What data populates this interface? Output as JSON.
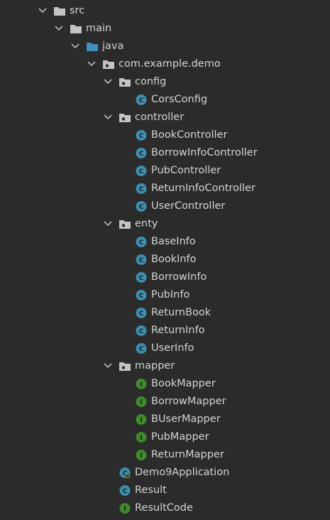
{
  "colors": {
    "background": "#2b2b2b",
    "text": "#d4d4d4",
    "folder": "#c4c4c4",
    "source_folder": "#3f8fc1",
    "class_icon": "#3d8fb0",
    "interface_icon": "#3e8a2c"
  },
  "tree": [
    {
      "label": "src",
      "depth": 0,
      "icon": "folder-icon",
      "expanded": true
    },
    {
      "label": "main",
      "depth": 1,
      "icon": "folder-icon",
      "expanded": true
    },
    {
      "label": "java",
      "depth": 2,
      "icon": "source-folder-icon",
      "expanded": true
    },
    {
      "label": "com.example.demo",
      "depth": 3,
      "icon": "package-icon",
      "expanded": true
    },
    {
      "label": "config",
      "depth": 4,
      "icon": "package-icon",
      "expanded": true
    },
    {
      "label": "CorsConfig",
      "depth": 5,
      "icon": "class-icon"
    },
    {
      "label": "controller",
      "depth": 4,
      "icon": "package-icon",
      "expanded": true
    },
    {
      "label": "BookController",
      "depth": 5,
      "icon": "class-icon"
    },
    {
      "label": "BorrowInfoController",
      "depth": 5,
      "icon": "class-icon"
    },
    {
      "label": "PubController",
      "depth": 5,
      "icon": "class-icon"
    },
    {
      "label": "ReturnInfoController",
      "depth": 5,
      "icon": "class-icon"
    },
    {
      "label": "UserController",
      "depth": 5,
      "icon": "class-icon"
    },
    {
      "label": "enty",
      "depth": 4,
      "icon": "package-icon",
      "expanded": true
    },
    {
      "label": "BaseInfo",
      "depth": 5,
      "icon": "class-icon"
    },
    {
      "label": "BookInfo",
      "depth": 5,
      "icon": "class-icon"
    },
    {
      "label": "BorrowInfo",
      "depth": 5,
      "icon": "class-icon"
    },
    {
      "label": "PubInfo",
      "depth": 5,
      "icon": "class-icon"
    },
    {
      "label": "ReturnBook",
      "depth": 5,
      "icon": "class-icon"
    },
    {
      "label": "ReturnInfo",
      "depth": 5,
      "icon": "class-icon"
    },
    {
      "label": "UserInfo",
      "depth": 5,
      "icon": "class-icon"
    },
    {
      "label": "mapper",
      "depth": 4,
      "icon": "package-icon",
      "expanded": true
    },
    {
      "label": "BookMapper",
      "depth": 5,
      "icon": "interface-icon"
    },
    {
      "label": "BorrowMapper",
      "depth": 5,
      "icon": "interface-icon"
    },
    {
      "label": "BUserMapper",
      "depth": 5,
      "icon": "interface-icon"
    },
    {
      "label": "PubMapper",
      "depth": 5,
      "icon": "interface-icon"
    },
    {
      "label": "ReturnMapper",
      "depth": 5,
      "icon": "interface-icon"
    },
    {
      "label": "Demo9Application",
      "depth": 4,
      "icon": "spring-boot-class-icon"
    },
    {
      "label": "Result",
      "depth": 4,
      "icon": "class-icon"
    },
    {
      "label": "ResultCode",
      "depth": 4,
      "icon": "interface-icon"
    }
  ]
}
